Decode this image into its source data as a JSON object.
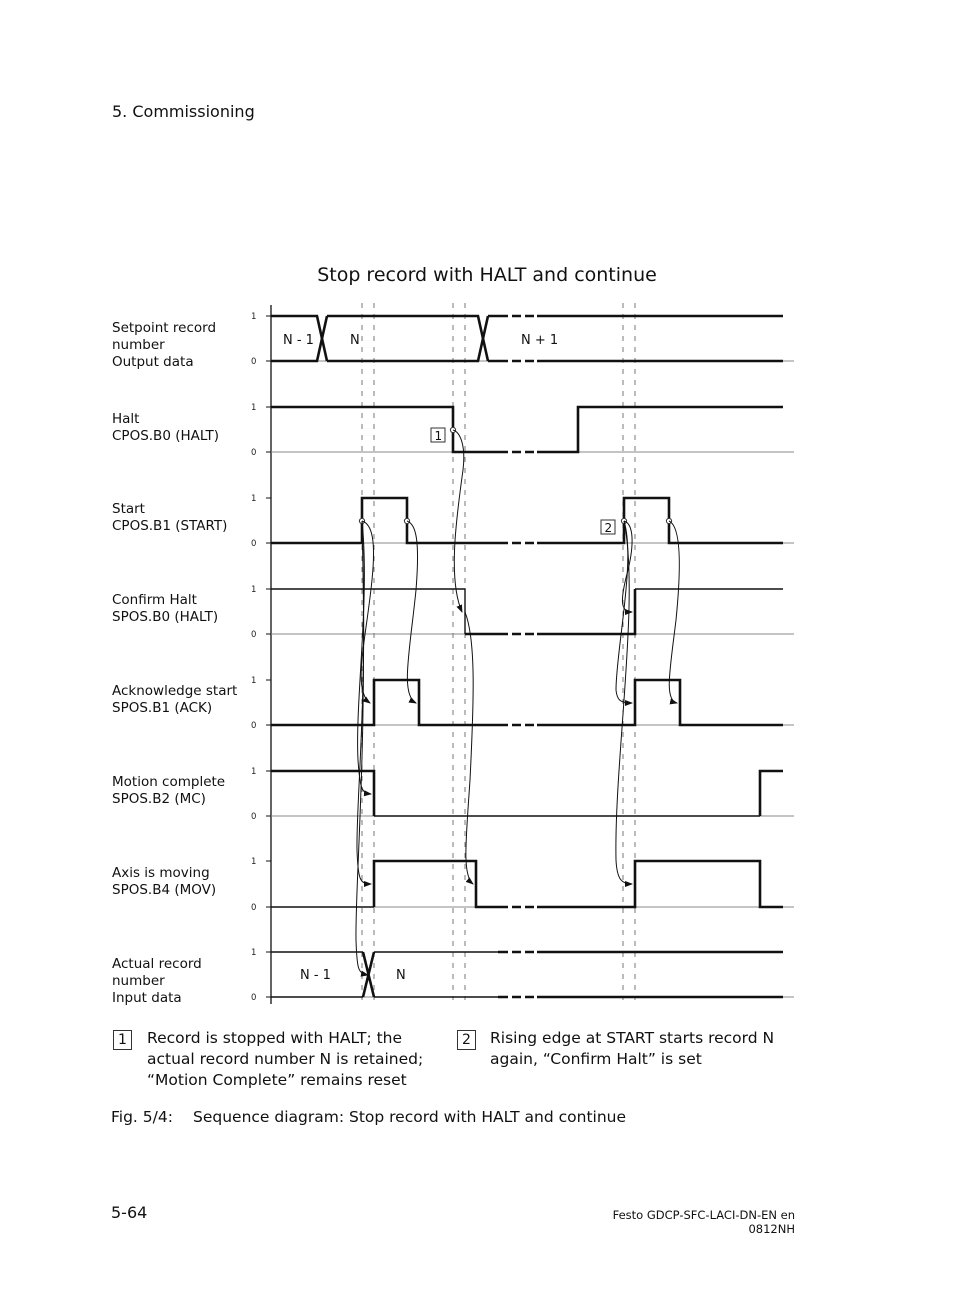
{
  "header": {
    "section": "5.  Commissioning"
  },
  "diagram": {
    "title": "Stop record with HALT and continue",
    "level_labels": {
      "high": "1",
      "low": "0"
    },
    "signals": [
      {
        "id": "setpoint",
        "label": "Setpoint record\nnumber\nOutput data",
        "kind": "bus",
        "segments": [
          {
            "text": "N - 1"
          },
          {
            "text": "N"
          },
          {
            "text": "N + 1"
          }
        ]
      },
      {
        "id": "halt",
        "label": "Halt\nCPOS.B0 (HALT)",
        "kind": "digital"
      },
      {
        "id": "start",
        "label": "Start\nCPOS.B1 (START)",
        "kind": "digital"
      },
      {
        "id": "confirm_halt",
        "label": "Confirm Halt\nSPOS.B0 (HALT)",
        "kind": "digital"
      },
      {
        "id": "ack",
        "label": "Acknowledge start\nSPOS.B1 (ACK)",
        "kind": "digital"
      },
      {
        "id": "mc",
        "label": "Motion complete\nSPOS.B2 (MC)",
        "kind": "digital"
      },
      {
        "id": "mov",
        "label": "Axis is moving\nSPOS.B4 (MOV)",
        "kind": "digital"
      },
      {
        "id": "actual",
        "label": "Actual record\nnumber\nInput data",
        "kind": "bus",
        "segments": [
          {
            "text": "N - 1"
          },
          {
            "text": "N"
          }
        ]
      }
    ],
    "markers": [
      {
        "id": "1"
      },
      {
        "id": "2"
      }
    ]
  },
  "notes": [
    {
      "marker": "1",
      "text": "Record is stopped with HALT; the\nactual record number N is retained;\n“Motion Complete” remains reset"
    },
    {
      "marker": "2",
      "text": "Rising edge at START starts record N\nagain, “Confirm Halt” is set"
    }
  ],
  "caption": {
    "number": "Fig. 5/4:",
    "text": "Sequence diagram: Stop record with HALT and continue"
  },
  "footer": {
    "page": "5-64",
    "doc": "Festo  GDCP-SFC-LACI-DN-EN  en 0812NH"
  }
}
